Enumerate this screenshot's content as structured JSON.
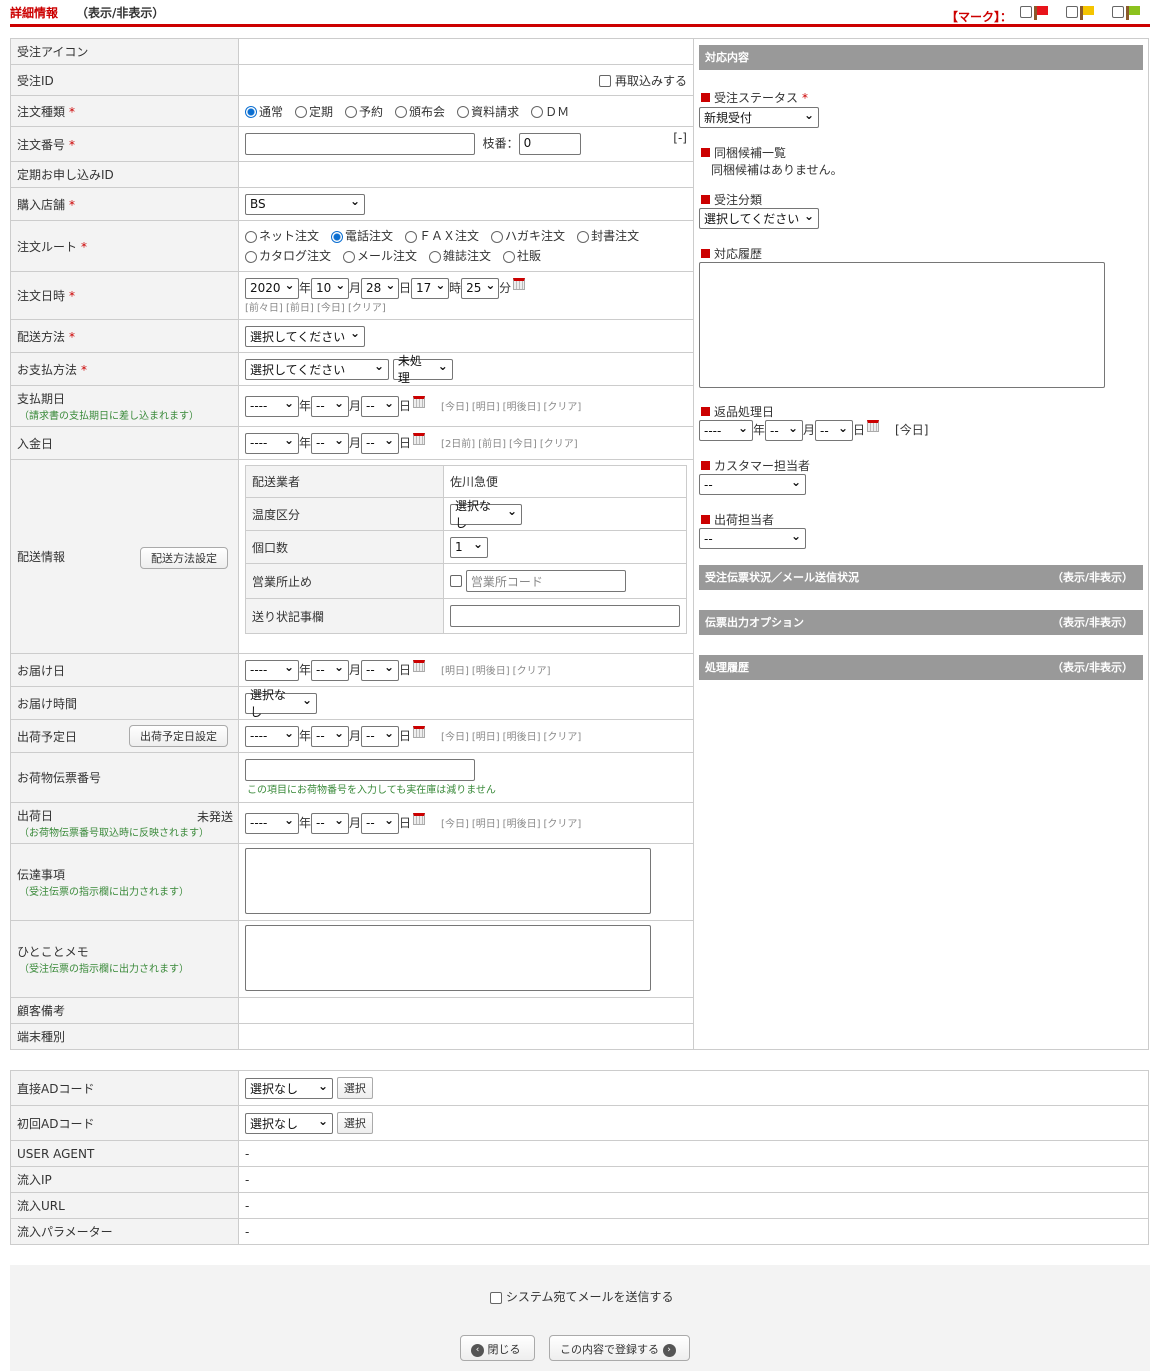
{
  "header": {
    "title": "詳細情報",
    "toggle": "（表示/非表示）",
    "mark_label": "【マーク】：",
    "flag_colors": [
      "#e8141b",
      "#f5c400",
      "#8cc21e"
    ]
  },
  "required_mark": "*",
  "left": {
    "order_icon": {
      "label": "受注アイコン"
    },
    "order_id": {
      "label": "受注ID",
      "reimport": "再取込みする"
    },
    "order_type": {
      "label": "注文種類",
      "options": [
        "通常",
        "定期",
        "予約",
        "頒布会",
        "資料請求",
        "ＤＭ"
      ],
      "selected": "通常"
    },
    "order_no": {
      "label": "注文番号",
      "value": "",
      "branch_label": "枝番：",
      "branch_value": "0",
      "collapse": "[-]"
    },
    "regular_id": {
      "label": "定期お申し込みID"
    },
    "store": {
      "label": "購入店舗",
      "value": "BS"
    },
    "route": {
      "label": "注文ルート",
      "options": [
        "ネット注文",
        "電話注文",
        "ＦＡＸ注文",
        "ハガキ注文",
        "封書注文",
        "カタログ注文",
        "メール注文",
        "雑誌注文",
        "社販"
      ],
      "selected": "電話注文"
    },
    "order_datetime": {
      "label": "注文日時",
      "year": "2020",
      "year_unit": "年",
      "month": "10",
      "month_unit": "月",
      "day": "28",
      "day_unit": "日",
      "hour": "17",
      "hour_unit": "時",
      "minute": "25",
      "minute_unit": "分",
      "links": [
        "[前々日]",
        "[前日]",
        "[今日]",
        "[クリア]"
      ]
    },
    "delivery_method": {
      "label": "配送方法",
      "value": "選択してください"
    },
    "payment": {
      "label": "お支払方法",
      "value": "選択してください",
      "status": "未処理"
    },
    "pay_due": {
      "label": "支払期日",
      "note": "（請求書の支払期日に差し込まれます）",
      "year": "----",
      "month": "--",
      "day": "--",
      "links": [
        "[今日]",
        "[明日]",
        "[明後日]",
        "[クリア]"
      ]
    },
    "deposit": {
      "label": "入金日",
      "year": "----",
      "month": "--",
      "day": "--",
      "links": [
        "[2日前]",
        "[前日]",
        "[今日]",
        "[クリア]"
      ]
    },
    "shipping": {
      "label": "配送情報",
      "button": "配送方法設定",
      "carrier_label": "配送業者",
      "carrier": "佐川急便",
      "temp_label": "温度区分",
      "temp": "選択なし",
      "boxes_label": "個口数",
      "boxes": "1",
      "office_label": "営業所止め",
      "office_placeholder": "営業所コード",
      "slip_note_label": "送り状記事欄",
      "slip_note": ""
    },
    "delivery_date": {
      "label": "お届け日",
      "year": "----",
      "month": "--",
      "day": "--",
      "links": [
        "[明日]",
        "[明後日]",
        "[クリア]"
      ]
    },
    "delivery_time": {
      "label": "お届け時間",
      "value": "選択なし"
    },
    "ship_plan": {
      "label": "出荷予定日",
      "button": "出荷予定日設定",
      "year": "----",
      "month": "--",
      "day": "--",
      "links": [
        "[今日]",
        "[明日]",
        "[明後日]",
        "[クリア]"
      ]
    },
    "tracking": {
      "label": "お荷物伝票番号",
      "value": "",
      "note": "この項目にお荷物番号を入力しても実在庫は減りません"
    },
    "ship_date": {
      "label": "出荷日",
      "status": "未発送",
      "note": "（お荷物伝票番号取込時に反映されます）",
      "year": "----",
      "month": "--",
      "day": "--",
      "links": [
        "[今日]",
        "[明日]",
        "[明後日]",
        "[クリア]"
      ]
    },
    "message": {
      "label": "伝達事項",
      "note": "（受注伝票の指示欄に出力されます）",
      "value": ""
    },
    "memo": {
      "label": "ひとことメモ",
      "note": "（受注伝票の指示欄に出力されます）",
      "value": ""
    },
    "customer_note": {
      "label": "顧客備考"
    },
    "device": {
      "label": "端末種別"
    }
  },
  "right": {
    "title": "対応内容",
    "status": {
      "label": "受注ステータス",
      "value": "新規受付"
    },
    "bundle": {
      "label": "同梱候補一覧",
      "text": "同梱候補はありません。"
    },
    "category": {
      "label": "受注分類",
      "value": "選択してください"
    },
    "history": {
      "label": "対応履歴",
      "value": ""
    },
    "return_date": {
      "label": "返品処理日",
      "year": "----",
      "month": "--",
      "day": "--",
      "link": "[今日]"
    },
    "cs_staff": {
      "label": "カスタマー担当者",
      "value": "--"
    },
    "ship_staff": {
      "label": "出荷担当者",
      "value": "--"
    },
    "bars": [
      {
        "title": "受注伝票状況／メール送信状況",
        "toggle": "（表示/非表示）"
      },
      {
        "title": "伝票出力オプション",
        "toggle": "（表示/非表示）"
      },
      {
        "title": "処理履歴",
        "toggle": "（表示/非表示）"
      }
    ]
  },
  "bottom": {
    "direct_ad": {
      "label": "直接ADコード",
      "value": "選択なし",
      "button": "選択"
    },
    "first_ad": {
      "label": "初回ADコード",
      "value": "選択なし",
      "button": "選択"
    },
    "user_agent": {
      "label": "USER AGENT",
      "value": "-"
    },
    "ip": {
      "label": "流入IP",
      "value": "-"
    },
    "url": {
      "label": "流入URL",
      "value": "-"
    },
    "params": {
      "label": "流入パラメーター",
      "value": "-"
    }
  },
  "footer": {
    "send_mail": "システム宛てメールを送信する",
    "close": "閉じる",
    "submit": "この内容で登録する"
  }
}
